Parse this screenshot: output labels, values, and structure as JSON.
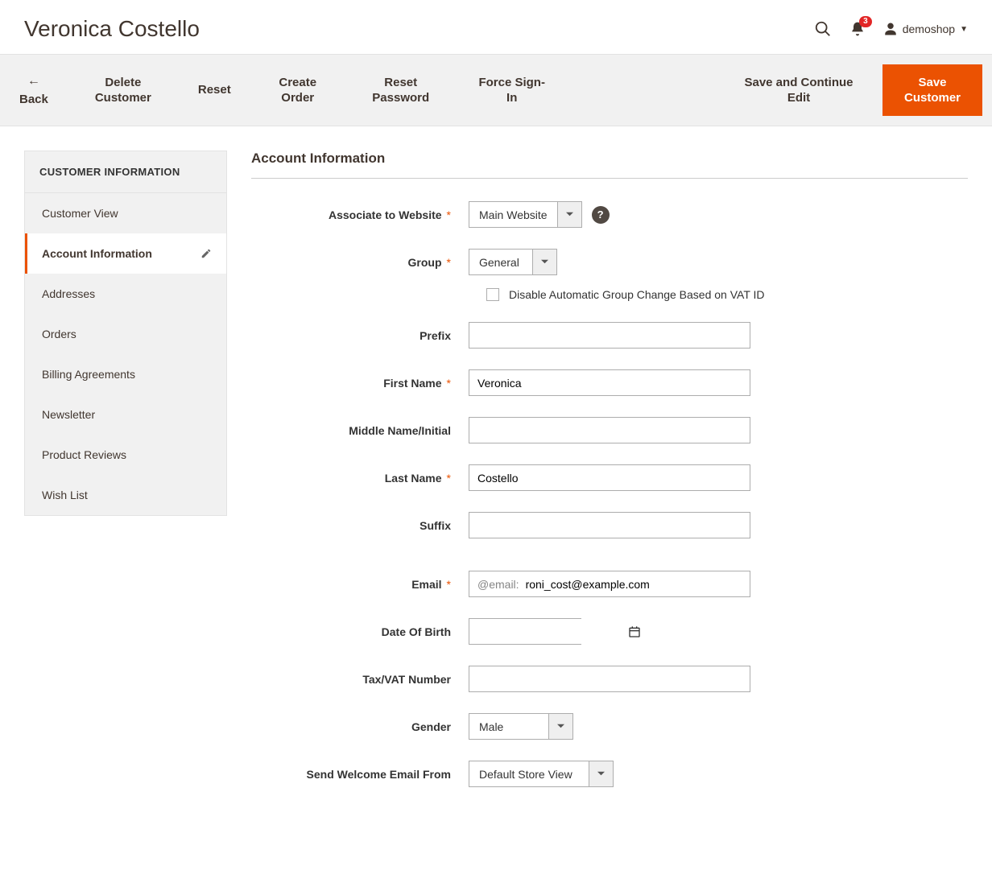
{
  "header": {
    "title": "Veronica Costello",
    "notification_count": "3",
    "username": "demoshop"
  },
  "actions": {
    "back": "Back",
    "delete": "Delete Customer",
    "reset": "Reset",
    "create_order": "Create Order",
    "reset_password": "Reset Password",
    "force_signin": "Force Sign-In",
    "save_continue": "Save and Continue Edit",
    "save": "Save Customer"
  },
  "sidebar": {
    "title": "CUSTOMER INFORMATION",
    "items": [
      {
        "label": "Customer View"
      },
      {
        "label": "Account Information"
      },
      {
        "label": "Addresses"
      },
      {
        "label": "Orders"
      },
      {
        "label": "Billing Agreements"
      },
      {
        "label": "Newsletter"
      },
      {
        "label": "Product Reviews"
      },
      {
        "label": "Wish List"
      }
    ]
  },
  "section_title": "Account Information",
  "form": {
    "associate_label": "Associate to Website",
    "associate_value": "Main Website",
    "group_label": "Group",
    "group_value": "General",
    "disable_auto_label": "Disable Automatic Group Change Based on VAT ID",
    "prefix_label": "Prefix",
    "prefix_value": "",
    "firstname_label": "First Name",
    "firstname_value": "Veronica",
    "middlename_label": "Middle Name/Initial",
    "middlename_value": "",
    "lastname_label": "Last Name",
    "lastname_value": "Costello",
    "suffix_label": "Suffix",
    "suffix_value": "",
    "email_label": "Email",
    "email_prefix": "@email:",
    "email_value": "roni_cost@example.com",
    "dob_label": "Date Of Birth",
    "dob_value": "",
    "taxvat_label": "Tax/VAT Number",
    "taxvat_value": "",
    "gender_label": "Gender",
    "gender_value": "Male",
    "welcome_label": "Send Welcome Email From",
    "welcome_value": "Default Store View"
  }
}
